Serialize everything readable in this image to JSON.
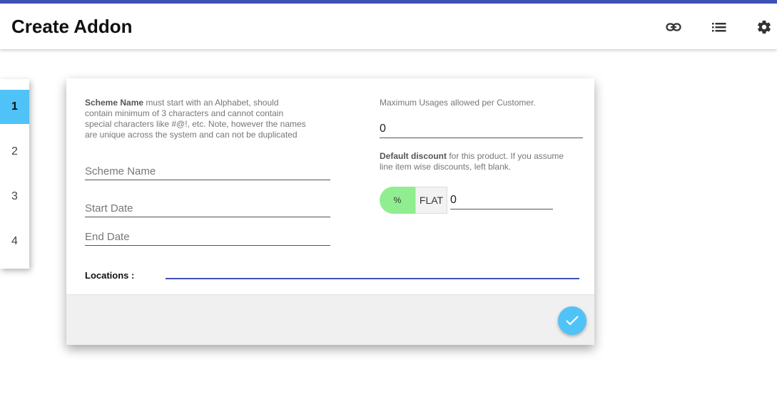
{
  "app": {
    "title": "Create Addon",
    "accent_color": "#3f51b5",
    "active_step_color": "#4fc3f7",
    "percent_toggle_color": "#90ee90"
  },
  "header": {
    "icons": [
      "link-icon",
      "list-icon",
      "gear-icon"
    ]
  },
  "stepper": {
    "steps": [
      "1",
      "2",
      "3",
      "4"
    ],
    "active": "1"
  },
  "form": {
    "scheme_hint_bold": "Scheme Name",
    "scheme_hint_rest": " must start with an Alphabet, should contain minimum of 3 characters and cannot contain special characters like #@!, etc. Note, however the names are unique across the system and can not be duplicated",
    "scheme_name_placeholder": "Scheme Name",
    "start_date_placeholder": "Start Date",
    "end_date_placeholder": "End Date",
    "max_usage_hint": "Maximum Usages allowed per Customer.",
    "max_usage_value": "0",
    "discount_hint_bold": "Default discount",
    "discount_hint_rest": " for this product. If you assume line item wise discounts, left blank.",
    "discount_percent_label": "%",
    "discount_flat_label": "FLAT",
    "discount_value": "0",
    "locations_label": "Locations :"
  },
  "footer": {
    "submit_icon": "check-icon"
  }
}
